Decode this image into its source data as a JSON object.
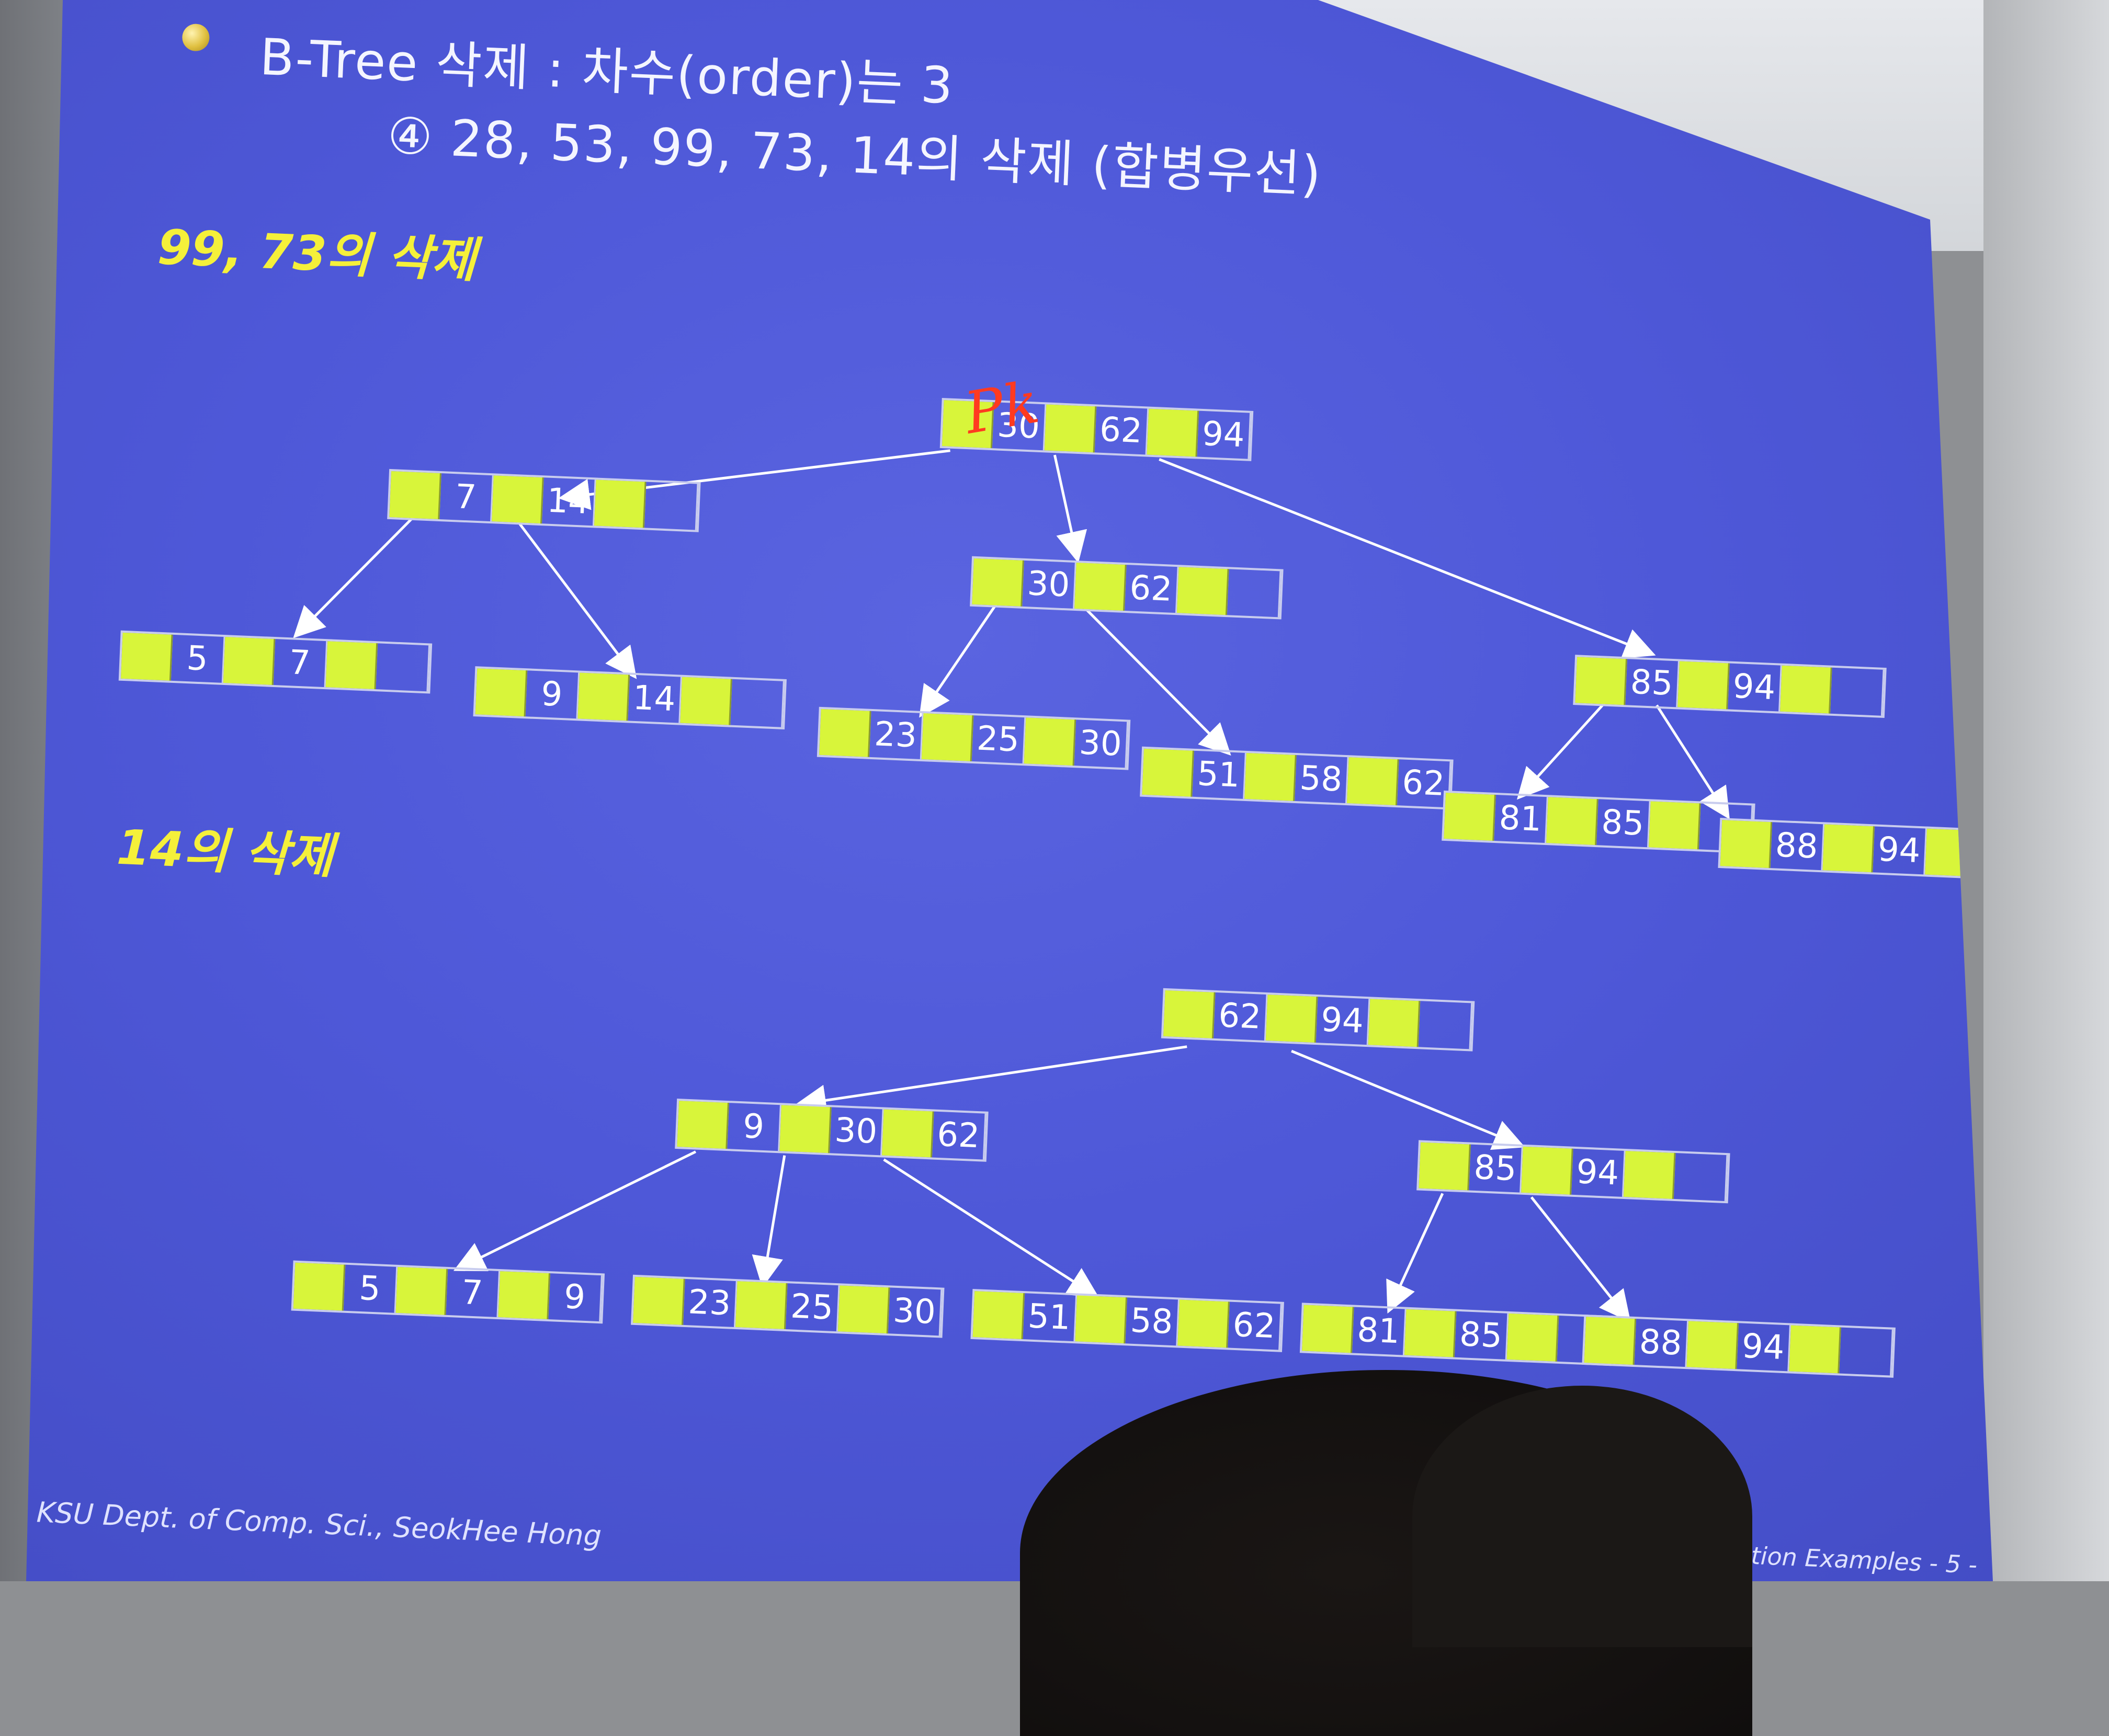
{
  "slide": {
    "title": "B-Tree 삭제 : 차수(order)는 3",
    "subtitle": "④ 28, 53, 99, 73, 14의 삭제 (합병우선)",
    "section1_label": "99, 73의 삭제",
    "section2_label": "14의 삭제",
    "annotation": "Pk",
    "footer_left": "KSU Dept. of Comp. Sci., SeokHee Hong",
    "footer_right": "tion/Deletion Examples  - 5 -"
  },
  "tree1": {
    "nodes": [
      {
        "id": "t1-root",
        "keys": [
          "30",
          "62",
          "94"
        ]
      },
      {
        "id": "t1-l1a",
        "keys": [
          "7",
          "14",
          ""
        ]
      },
      {
        "id": "t1-l1b",
        "keys": [
          "30",
          "62",
          ""
        ]
      },
      {
        "id": "t1-l1c",
        "keys": [
          "85",
          "94",
          ""
        ]
      },
      {
        "id": "t1-leaf1",
        "keys": [
          "5",
          "7",
          ""
        ]
      },
      {
        "id": "t1-leaf2",
        "keys": [
          "9",
          "14",
          ""
        ]
      },
      {
        "id": "t1-leaf3",
        "keys": [
          "23",
          "25",
          "30"
        ]
      },
      {
        "id": "t1-leaf4",
        "keys": [
          "51",
          "58",
          "62"
        ]
      },
      {
        "id": "t1-leaf5",
        "keys": [
          "81",
          "85",
          ""
        ]
      },
      {
        "id": "t1-leaf6",
        "keys": [
          "88",
          "94",
          ""
        ]
      }
    ]
  },
  "tree2": {
    "nodes": [
      {
        "id": "t2-root",
        "keys": [
          "62",
          "94",
          ""
        ]
      },
      {
        "id": "t2-l1a",
        "keys": [
          "9",
          "30",
          "62"
        ]
      },
      {
        "id": "t2-l1b",
        "keys": [
          "85",
          "94",
          ""
        ]
      },
      {
        "id": "t2-leaf1",
        "keys": [
          "5",
          "7",
          "9"
        ]
      },
      {
        "id": "t2-leaf2",
        "keys": [
          "23",
          "25",
          "30"
        ]
      },
      {
        "id": "t2-leaf3",
        "keys": [
          "51",
          "58",
          "62"
        ]
      },
      {
        "id": "t2-leaf4",
        "keys": [
          "81",
          "85",
          ""
        ]
      },
      {
        "id": "t2-leaf5",
        "keys": [
          "88",
          "94",
          ""
        ]
      }
    ]
  },
  "colors": {
    "slide_bg": "#4e58d8",
    "pointer_cell": "#d8f53a",
    "section_label": "#f5f03a",
    "annotation": "#ff3a20"
  }
}
